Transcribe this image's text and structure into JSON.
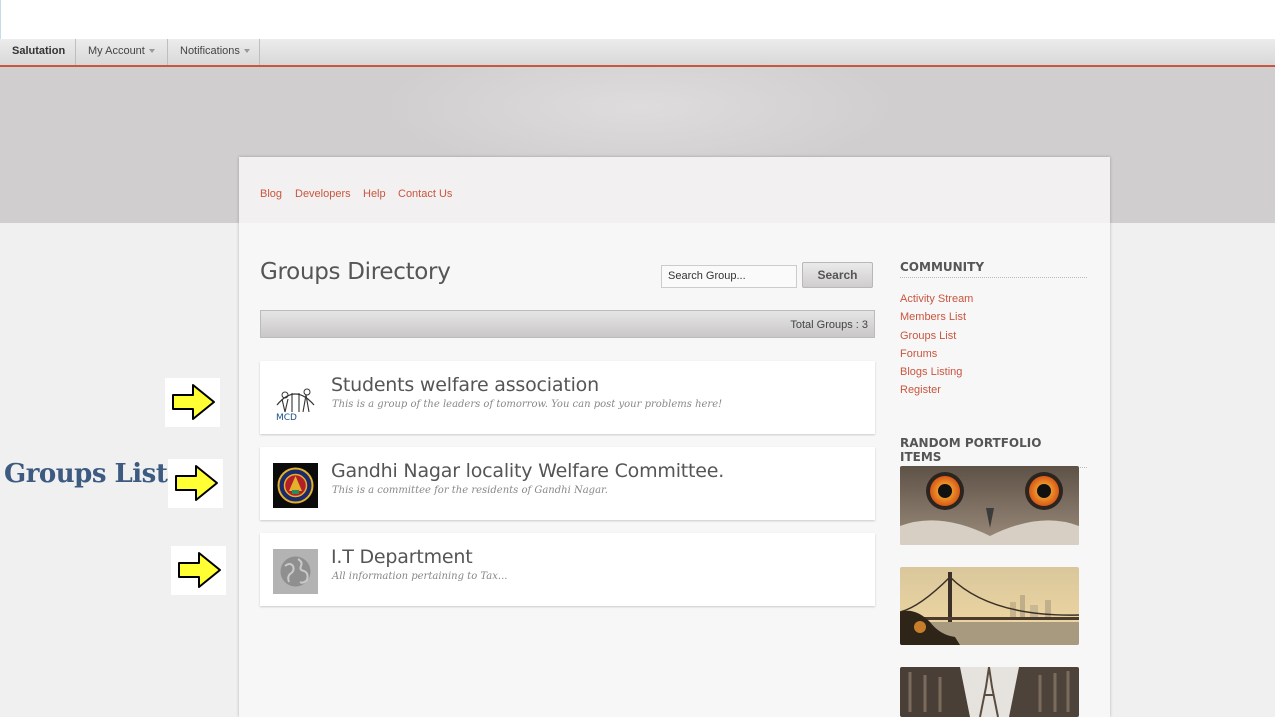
{
  "menubar": {
    "items": [
      {
        "label": "Salutation"
      },
      {
        "label": "My Account"
      },
      {
        "label": "Notifications"
      }
    ]
  },
  "top_links": [
    "Blog",
    "Developers",
    "Help",
    "Contact Us"
  ],
  "main": {
    "title": "Groups Directory",
    "search": {
      "placeholder": "Search Group...",
      "button_label": "Search"
    },
    "total_groups": "Total Groups : 3",
    "groups": [
      {
        "name": "Students welfare association",
        "description": "This is a group of the leaders of tomorrow. You can post your problems here!",
        "avatar_icon": "mcd-logo-icon"
      },
      {
        "name": "Gandhi Nagar locality Welfare Committee.",
        "description": "This is a committee for the residents of Gandhi Nagar.",
        "avatar_icon": "emblem-logo-icon"
      },
      {
        "name": "I.T Department",
        "description": "All information pertaining to Tax...",
        "avatar_icon": "globe-icon"
      }
    ]
  },
  "sidebar": {
    "community_heading": "COMMUNITY",
    "community_links": [
      "Activity Stream",
      "Members List",
      "Groups List",
      "Forums",
      "Blogs Listing",
      "Register"
    ],
    "portfolio_heading": "RANDOM PORTFOLIO ITEMS",
    "portfolio_items": [
      "owl-eyes-image",
      "bridge-city-image",
      "eiffel-street-image"
    ]
  },
  "annotation": {
    "label": "Groups List",
    "arrow_icon": "yellow-right-arrow-icon"
  },
  "colors": {
    "accent": "#c9563f",
    "annotation_label": "#3d5a80",
    "arrow_fill": "#ffff33"
  }
}
